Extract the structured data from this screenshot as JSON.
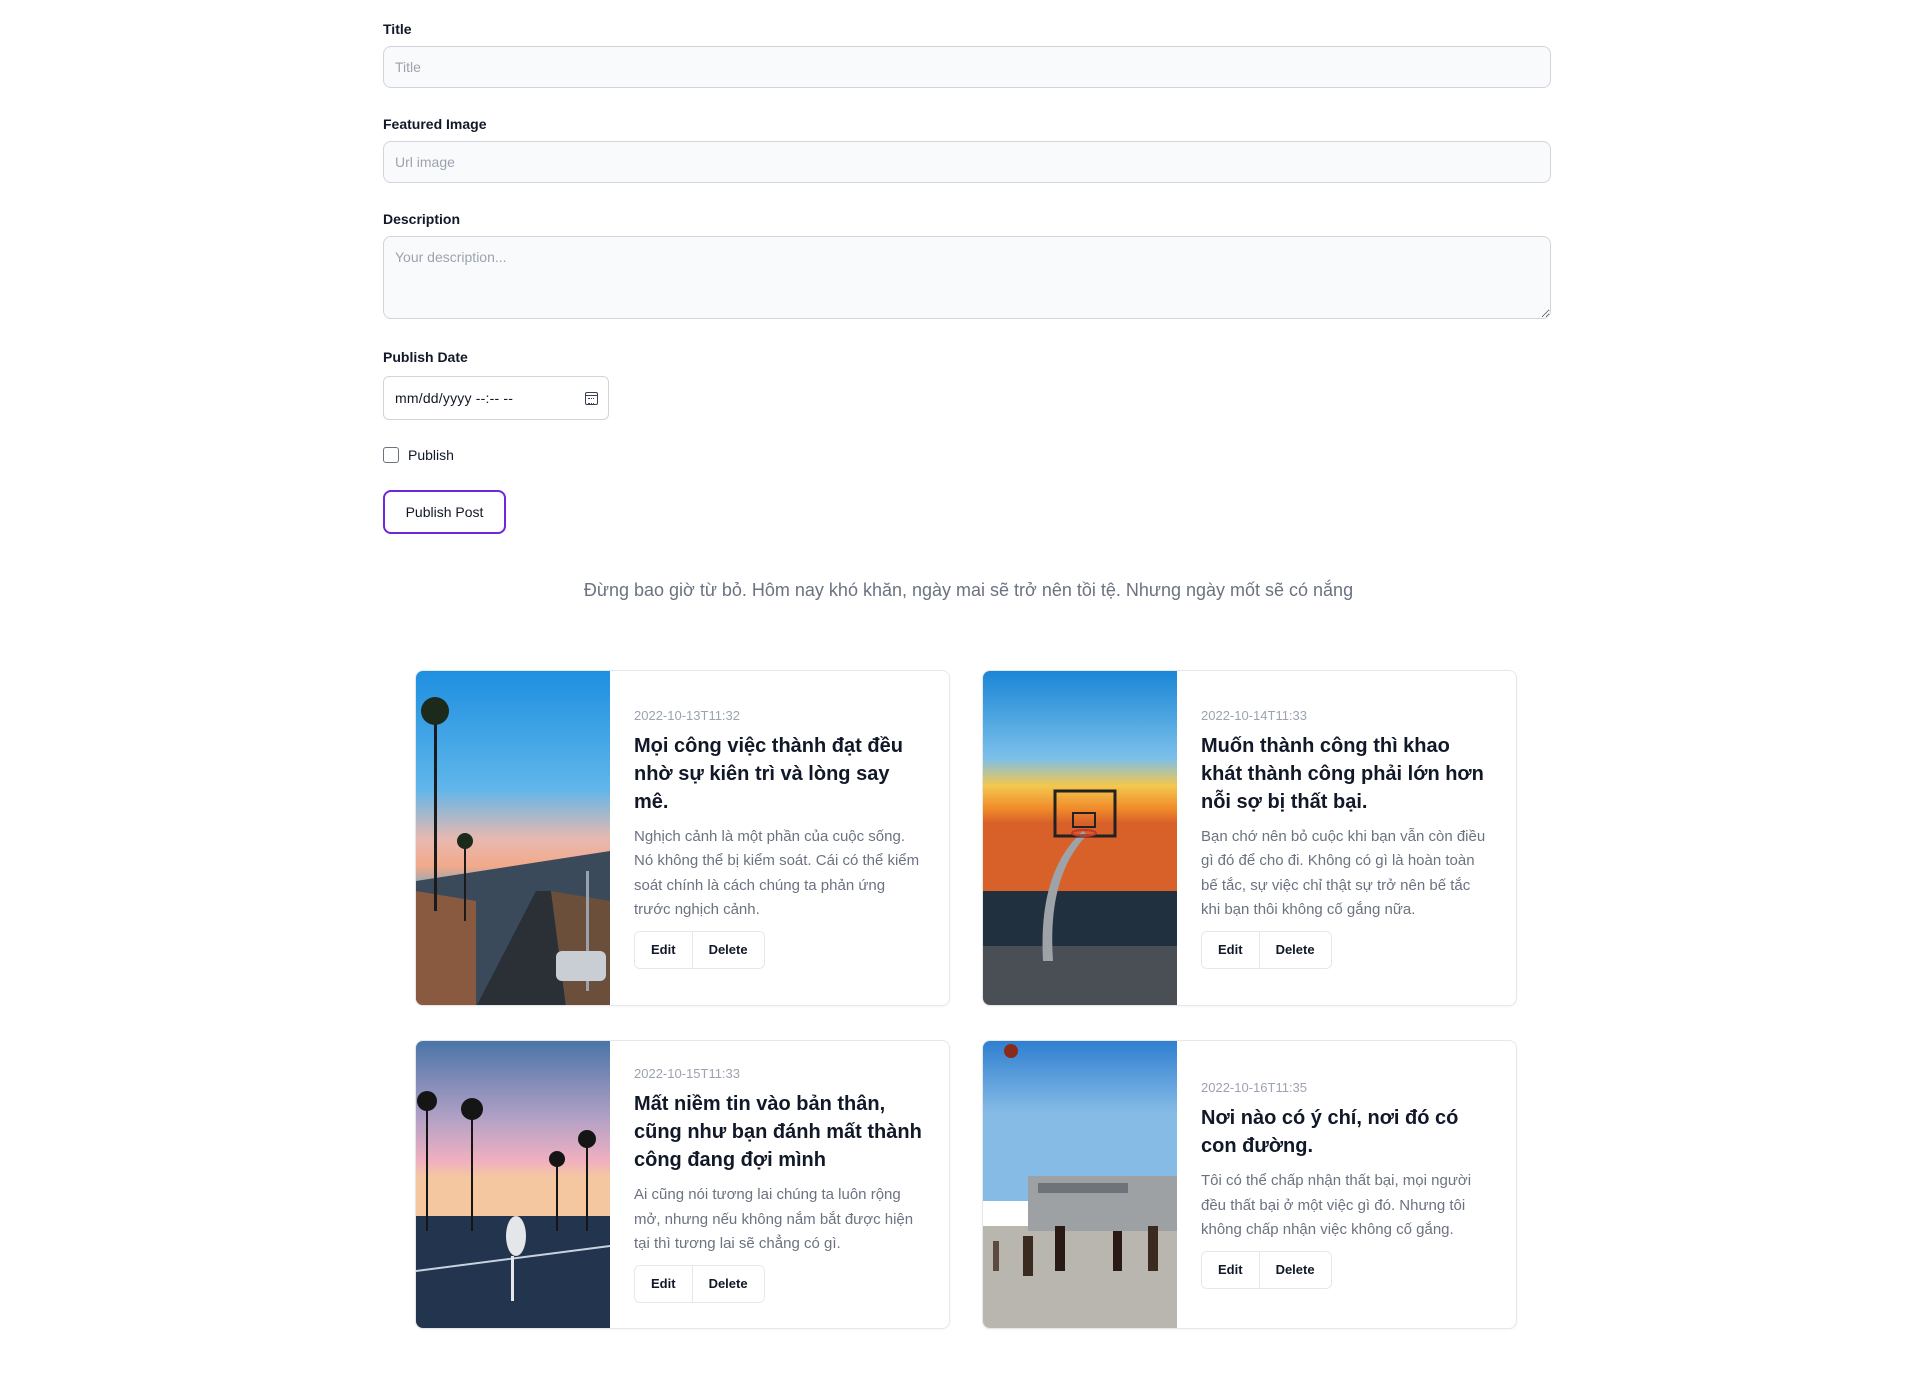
{
  "form": {
    "title_label": "Title",
    "title_placeholder": "Title",
    "image_label": "Featured Image",
    "image_placeholder": "Url image",
    "description_label": "Description",
    "description_placeholder": "Your description...",
    "date_label": "Publish Date",
    "date_value": "mm/dd/yyyy --:-- --",
    "publish_checkbox_label": "Publish",
    "publish_button": "Publish Post"
  },
  "quote": "Đừng bao giờ từ bỏ. Hôm nay khó khăn, ngày mai sẽ trở nên tồi tệ. Nhưng ngày mốt sẽ có nắng",
  "posts": [
    {
      "date": "2022-10-13T11:32",
      "title": "Mọi công việc thành đạt đều nhờ sự kiên trì và lòng say mê.",
      "description": "Nghịch cảnh là một phần của cuộc sống. Nó không thể bị kiểm soát. Cái có thể kiểm soát chính là cách chúng ta phản ứng trước nghịch cảnh.",
      "edit": "Edit",
      "delete": "Delete"
    },
    {
      "date": "2022-10-14T11:33",
      "title": "Muốn thành công thì khao khát thành công phải lớn hơn nỗi sợ bị thất bại.",
      "description": "Bạn chớ nên bỏ cuộc khi bạn vẫn còn điều gì đó để cho đi. Không có gì là hoàn toàn bế tắc, sự việc chỉ thật sự trở nên bế tắc khi bạn thôi không cố gắng nữa.",
      "edit": "Edit",
      "delete": "Delete"
    },
    {
      "date": "2022-10-15T11:33",
      "title": "Mất niềm tin vào bản thân, cũng như bạn đánh mất thành công đang đợi mình",
      "description": "Ai cũng nói tương lai chúng ta luôn rộng mở, nhưng nếu không nắm bắt được hiện tại thì tương lai sẽ chẳng có gì.",
      "edit": "Edit",
      "delete": "Delete"
    },
    {
      "date": "2022-10-16T11:35",
      "title": "Nơi nào có ý chí, nơi đó có con đường.",
      "description": "Tôi có thể chấp nhận thất bại, mọi người đều thất bại ở một việc gì đó. Nhưng tôi không chấp nhận việc không cố gắng.",
      "edit": "Edit",
      "delete": "Delete"
    }
  ]
}
